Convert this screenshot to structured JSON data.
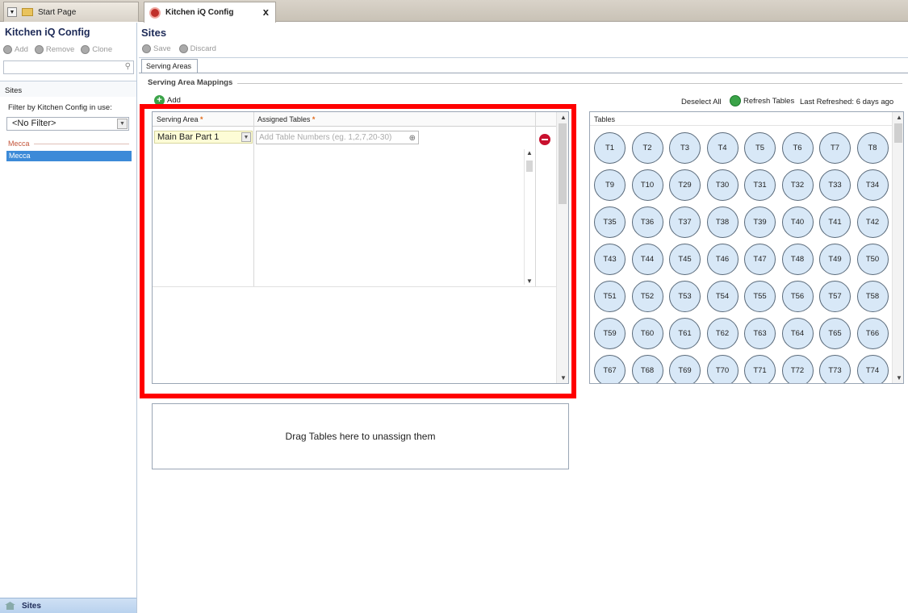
{
  "tabs": [
    {
      "label": "Start Page",
      "icon": "folder-icon"
    },
    {
      "label": "Kitchen iQ Config",
      "icon": "app-icon",
      "close": "x"
    }
  ],
  "left": {
    "title": "Kitchen iQ Config",
    "toolbar": {
      "add": "Add",
      "remove": "Remove",
      "clone": "Clone"
    },
    "search_icon": "⚲",
    "sites_label": "Sites",
    "filter_label": "Filter by Kitchen Config in use:",
    "filter_value": "<No Filter>",
    "group_label": "Mecca",
    "site_item": "Mecca",
    "footer": "Sites"
  },
  "main": {
    "title": "Sites",
    "toolbar": {
      "save": "Save",
      "discard": "Discard"
    },
    "subtab": "Serving Areas",
    "section": "Serving Area Mappings",
    "add": "Add",
    "grid": {
      "col_serving_area": "Serving Area",
      "col_assigned_tables": "Assigned Tables",
      "required_mark": "*",
      "row": {
        "serving_area": "Main Bar Part 1",
        "tables_placeholder": "Add Table Numbers (eg. 1,2,7,20-30)"
      }
    },
    "dropzone": "Drag Tables here to unassign them"
  },
  "right": {
    "deselect_all": "Deselect All",
    "refresh": "Refresh Tables",
    "last_refreshed": "Last Refreshed: 6 days ago",
    "tables_label": "Tables",
    "tables": [
      "T1",
      "T2",
      "T3",
      "T4",
      "T5",
      "T6",
      "T7",
      "T8",
      "T9",
      "T10",
      "T29",
      "T30",
      "T31",
      "T32",
      "T33",
      "T34",
      "T35",
      "T36",
      "T37",
      "T38",
      "T39",
      "T40",
      "T41",
      "T42",
      "T43",
      "T44",
      "T45",
      "T46",
      "T47",
      "T48",
      "T49",
      "T50",
      "T51",
      "T52",
      "T53",
      "T54",
      "T55",
      "T56",
      "T57",
      "T58",
      "T59",
      "T60",
      "T61",
      "T62",
      "T63",
      "T64",
      "T65",
      "T66",
      "T67",
      "T68",
      "T69",
      "T70",
      "T71",
      "T72",
      "T73",
      "T74"
    ]
  },
  "colors": {
    "highlight": "#ff0000",
    "table_fill": "#d8e8f7",
    "selection": "#3c8ad8"
  }
}
